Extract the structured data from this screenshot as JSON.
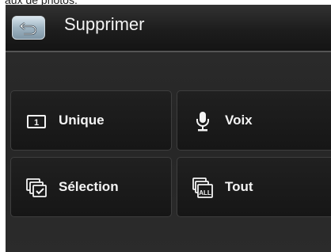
{
  "caption": "aux de photos.",
  "header": {
    "title": "Supprimer"
  },
  "options": {
    "unique": {
      "label": "Unique",
      "icon": "single-image-icon",
      "icon_text": "1"
    },
    "voix": {
      "label": "Voix",
      "icon": "microphone-icon"
    },
    "selection": {
      "label": "Sélection",
      "icon": "select-images-icon"
    },
    "tout": {
      "label": "Tout",
      "icon": "all-images-icon",
      "icon_text": "ALL"
    }
  },
  "colors": {
    "screen_bg": "#1e1e1e",
    "text": "#f4f4f4",
    "back_button": "#9fb4c2"
  }
}
